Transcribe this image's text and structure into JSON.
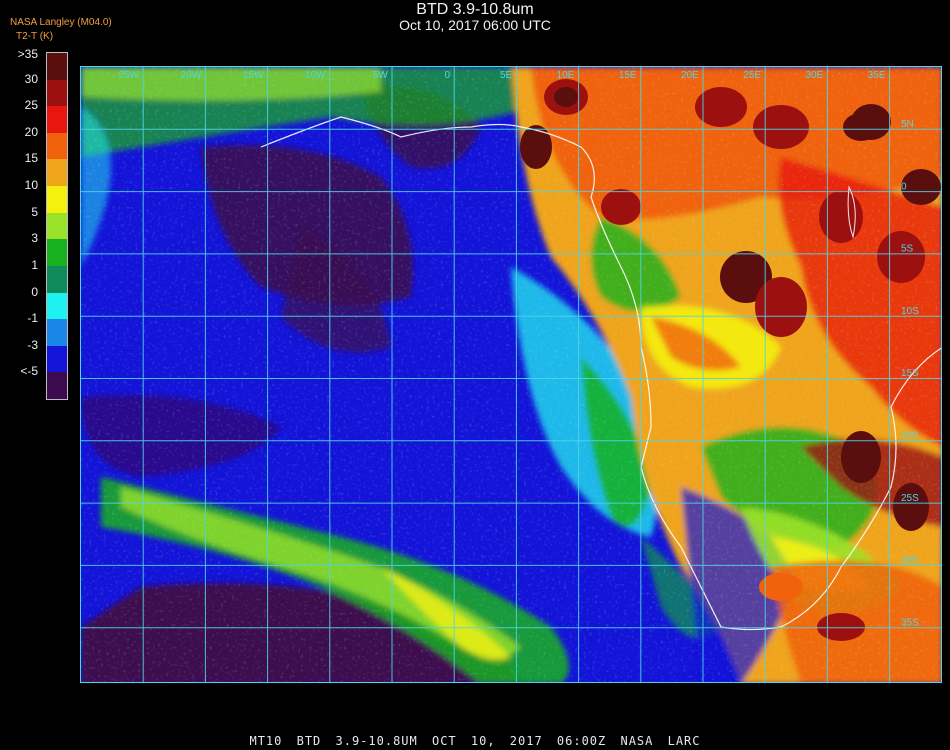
{
  "header": {
    "title": "BTD 3.9-10.8um",
    "subtitle": "Oct 10, 2017 06:00 UTC",
    "source_line1": "NASA Langley (M04.0)",
    "source_line2": "T2-T (K)"
  },
  "legend": {
    "unit": "BTD (K)",
    "entries": [
      {
        "label": ">35",
        "color": "#5a0e0e"
      },
      {
        "label": "30",
        "color": "#9c1010"
      },
      {
        "label": "25",
        "color": "#e8160e"
      },
      {
        "label": "20",
        "color": "#f0620c"
      },
      {
        "label": "15",
        "color": "#f0a41a"
      },
      {
        "label": "10",
        "color": "#f4f010"
      },
      {
        "label": "5",
        "color": "#9ae22a"
      },
      {
        "label": "3",
        "color": "#17b01e"
      },
      {
        "label": "1",
        "color": "#0f8a5a"
      },
      {
        "label": "0",
        "color": "#1ff0f0"
      },
      {
        "label": "-1",
        "color": "#1a86e8"
      },
      {
        "label": "-3",
        "color": "#1414d8"
      },
      {
        "label": "<-5",
        "color": "#3c0a4e"
      }
    ]
  },
  "map": {
    "grid_color": "#4fd5e6",
    "coast_color": "#ffffff",
    "lon_labels": [
      "25W",
      "20W",
      "15W",
      "10W",
      "5W",
      "0",
      "5E",
      "10E",
      "15E",
      "20E",
      "25E",
      "30E",
      "35E"
    ],
    "lat_labels": [
      "5N",
      "0",
      "5S",
      "10S",
      "15S",
      "20S",
      "25S",
      "30S",
      "35S"
    ]
  },
  "footer": {
    "text": "MT10 BTD 3.9-10.8UM OCT 10, 2017 06:00Z NASA LARC"
  }
}
